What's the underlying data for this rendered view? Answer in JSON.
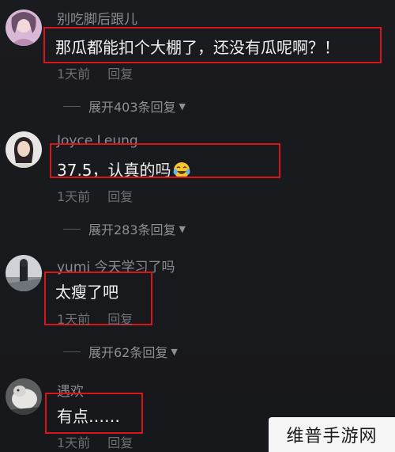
{
  "comments": [
    {
      "username": "别吃脚后跟儿",
      "text": "那瓜都能扣个大棚了，还没有瓜呢啊？！",
      "time": "1天前",
      "reply_label": "回复",
      "expand_label": "展开403条回复"
    },
    {
      "username": "Joyce Leung",
      "text": "37.5，认真的吗",
      "emoji": "laughing-tears-emoji",
      "time": "1天前",
      "reply_label": "回复",
      "expand_label": "展开283条回复"
    },
    {
      "username": "yumi 今天学习了吗",
      "text": "太瘦了吧",
      "time": "1天前",
      "reply_label": "回复",
      "expand_label": "展开62条回复"
    },
    {
      "username": "遇欢",
      "text": "有点……",
      "time": "1天前",
      "reply_label": "回复"
    }
  ],
  "watermark": {
    "text": "维普手游网"
  },
  "colors": {
    "background": "#17181c",
    "highlight_border": "#d9151a",
    "username": "#8a8c91",
    "comment_text": "#f1f1f1"
  }
}
